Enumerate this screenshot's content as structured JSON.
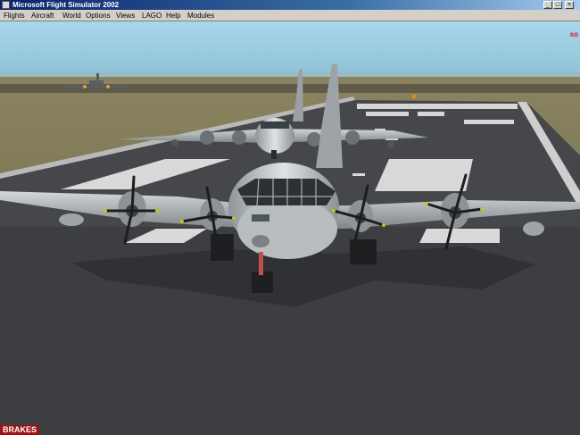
{
  "window": {
    "title": "Microsoft Flight Simulator 2002"
  },
  "caption_buttons": {
    "minimize": "_",
    "maximize": "□",
    "close": "×"
  },
  "menu": {
    "items": [
      "Flights",
      "Aircraft",
      "World",
      "Options",
      "Views",
      "LAGO",
      "Help",
      "Modules"
    ]
  },
  "hud": {
    "indicator": "so",
    "brakes": "BRAKES"
  },
  "icons": {
    "app": "flight-sim-app-icon"
  }
}
